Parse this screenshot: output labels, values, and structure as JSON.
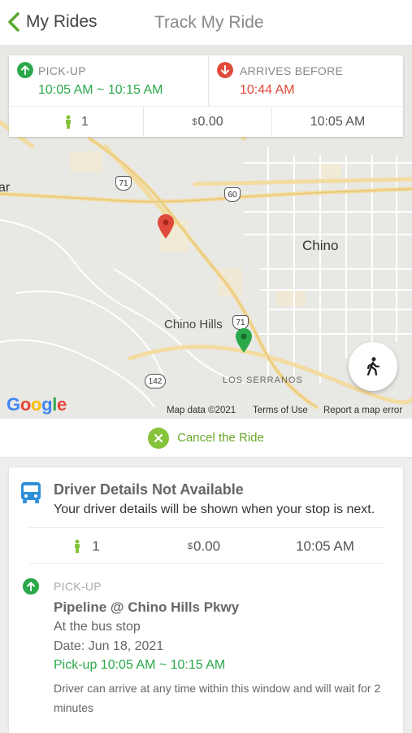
{
  "header": {
    "back_label": "My Rides",
    "title": "Track My Ride"
  },
  "trip": {
    "pickup_label": "PICK-UP",
    "pickup_window": "10:05 AM ~ 10:15 AM",
    "arrive_label": "ARRIVES BEFORE",
    "arrive_time": "10:44 AM",
    "passengers": "1",
    "fare": "0.00",
    "fare_symbol": "$",
    "time": "10:05 AM"
  },
  "map": {
    "places": {
      "chino": "Chino",
      "chino_hills": "Chino Hills",
      "los_serranos": "LOS SERRANOS",
      "ar": "ar"
    },
    "shields": {
      "r71": "71",
      "r60": "60",
      "r71b": "71",
      "r142": "142"
    },
    "attribution": {
      "data": "Map data ©2021",
      "terms": "Terms of Use",
      "report": "Report a map error"
    },
    "logo": "Google",
    "colors": {
      "dropoff_pin": "#e04a3a",
      "pickup_pin": "#2aa84a",
      "road": "#f3dca0"
    }
  },
  "cancel": {
    "label": "Cancel the Ride"
  },
  "driver": {
    "title": "Driver Details Not Available",
    "subtitle": "Your driver details will be shown when your stop is next.",
    "passengers": "1",
    "fare": "0.00",
    "fare_symbol": "$",
    "time": "10:05 AM"
  },
  "pickup_detail": {
    "label": "PICK-UP",
    "stop": "Pipeline @ Chino Hills Pkwy",
    "location": "At the bus stop",
    "date": "Date: Jun 18, 2021",
    "window": "Pick-up 10:05 AM ~ 10:15 AM",
    "note": "Driver can arrive at any time within this window and will wait for 2 minutes"
  },
  "colors": {
    "green": "#2aa84a",
    "red": "#e04a3a",
    "cancel_green": "#86c33a",
    "bus_blue": "#2f8fd8"
  }
}
